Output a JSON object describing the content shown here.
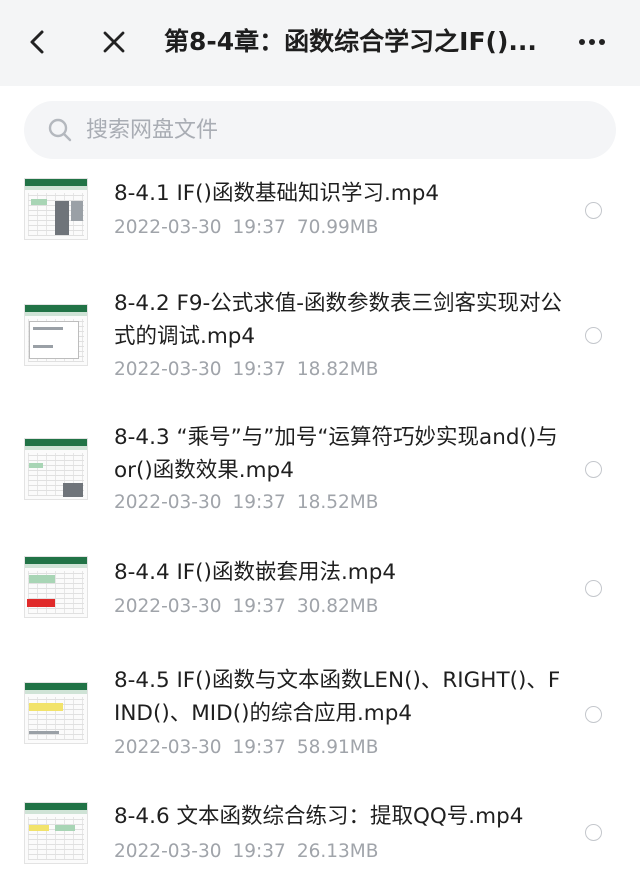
{
  "header": {
    "title": "第8-4章：函数综合学习之IF()...",
    "back_icon": "chevron-left-icon",
    "close_icon": "close-icon",
    "more_icon": "more-horizontal-icon"
  },
  "search": {
    "placeholder": "搜索网盘文件",
    "value": "",
    "icon": "search-icon"
  },
  "colors": {
    "header_bg": "#f4f5f6",
    "search_bg": "#f4f5f7",
    "meta_text": "#a0a4aa",
    "excel_green": "#217346"
  },
  "files": [
    {
      "name": "8-4.1 IF()函数基础知识学习.mp4",
      "date": "2022-03-30",
      "time": "19:37",
      "size": "70.99MB"
    },
    {
      "name": "8-4.2 F9-公式求值-函数参数表三剑客实现对公式的调试.mp4",
      "date": "2022-03-30",
      "time": "19:37",
      "size": "18.82MB"
    },
    {
      "name": "8-4.3 “乘号”与”加号“运算符巧妙实现and()与or()函数效果.mp4",
      "date": "2022-03-30",
      "time": "19:37",
      "size": "18.52MB"
    },
    {
      "name": "8-4.4 IF()函数嵌套用法.mp4",
      "date": "2022-03-30",
      "time": "19:37",
      "size": "30.82MB"
    },
    {
      "name": "8-4.5 IF()函数与文本函数LEN()、RIGHT()、FIND()、MID()的综合应用.mp4",
      "date": "2022-03-30",
      "time": "19:37",
      "size": "58.91MB"
    },
    {
      "name": "8-4.6 文本函数综合练习：提取QQ号.mp4",
      "date": "2022-03-30",
      "time": "19:37",
      "size": "26.13MB"
    }
  ]
}
